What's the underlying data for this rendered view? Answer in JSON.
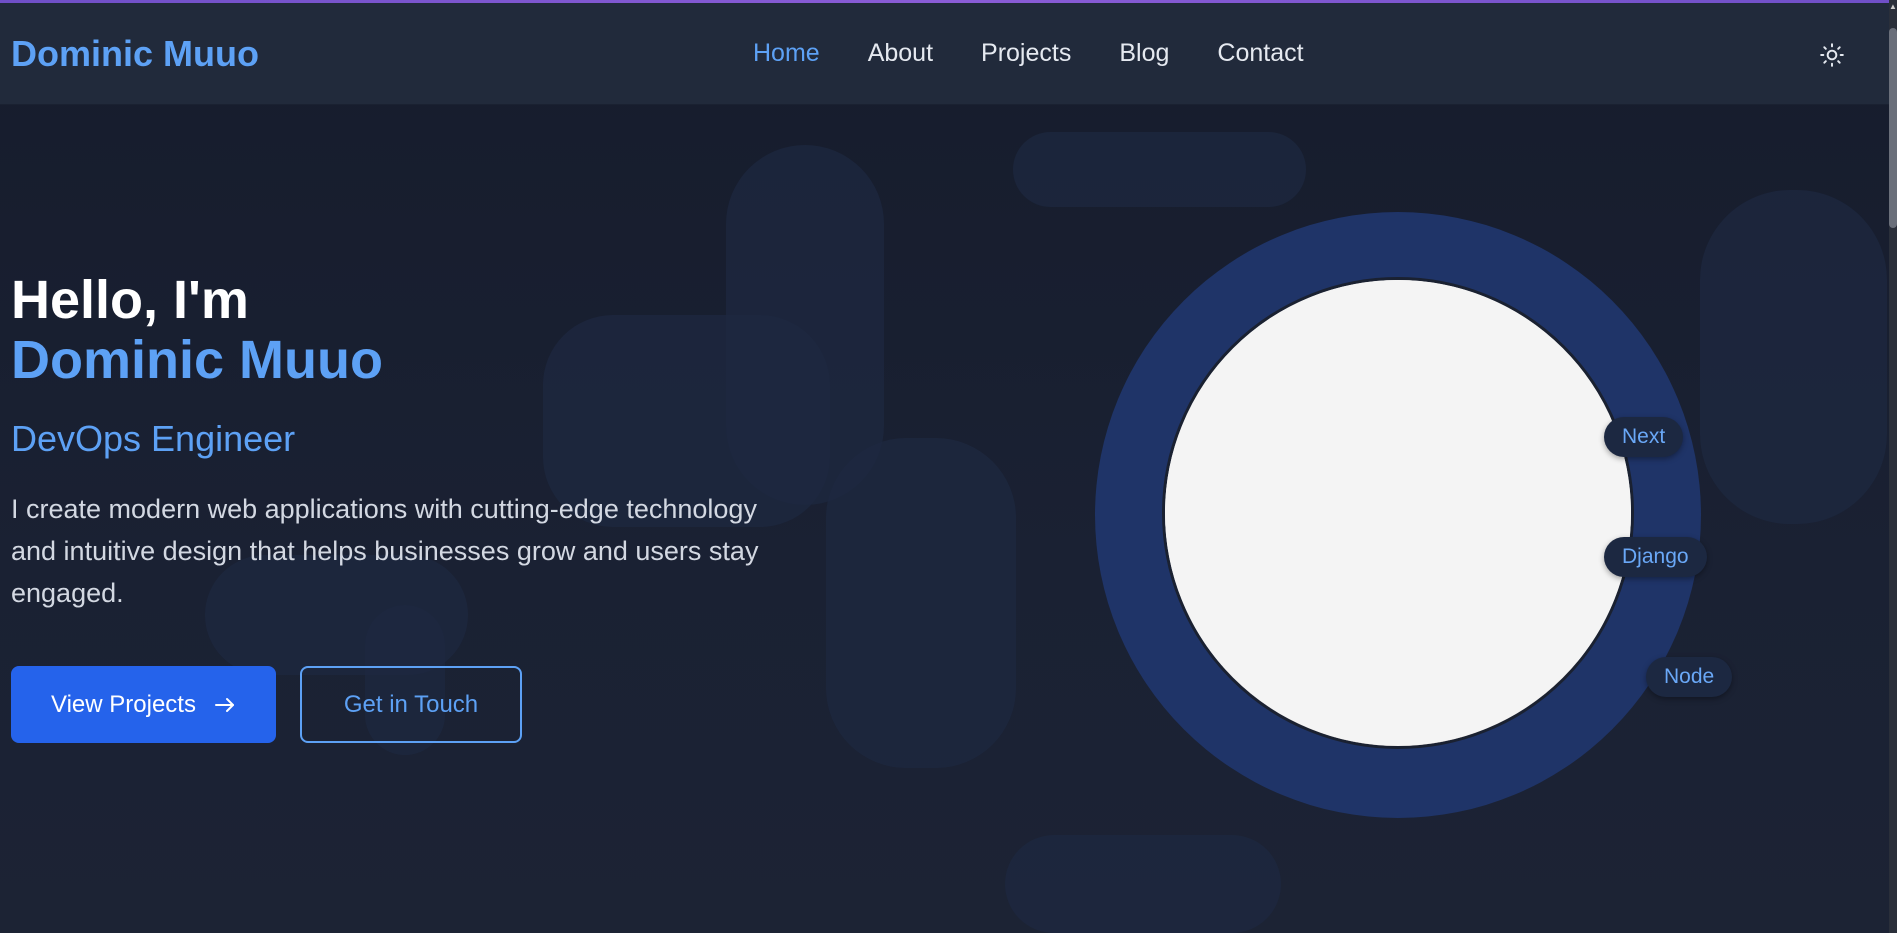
{
  "brand": {
    "name": "Dominic Muuo"
  },
  "nav": {
    "items": [
      {
        "label": "Home",
        "active": true
      },
      {
        "label": "About",
        "active": false
      },
      {
        "label": "Projects",
        "active": false
      },
      {
        "label": "Blog",
        "active": false
      },
      {
        "label": "Contact",
        "active": false
      }
    ],
    "theme_toggle_icon": "sun-icon"
  },
  "hero": {
    "greeting": "Hello, I'm",
    "name": "Dominic Muuo",
    "role": "DevOps Engineer",
    "intro": "I create modern web applications with cutting-edge technology and intuitive design that helps businesses grow and users stay engaged.",
    "primary_cta": "View Projects",
    "primary_cta_icon": "arrow-right-icon",
    "secondary_cta": "Get in Touch"
  },
  "tech_tags": [
    "Next",
    "Django",
    "Node"
  ],
  "colors": {
    "accent": "#5da1f5",
    "primary_button": "#2563eb",
    "background": "#1a2030",
    "header": "#212a3b",
    "ring": "#1f3468"
  }
}
